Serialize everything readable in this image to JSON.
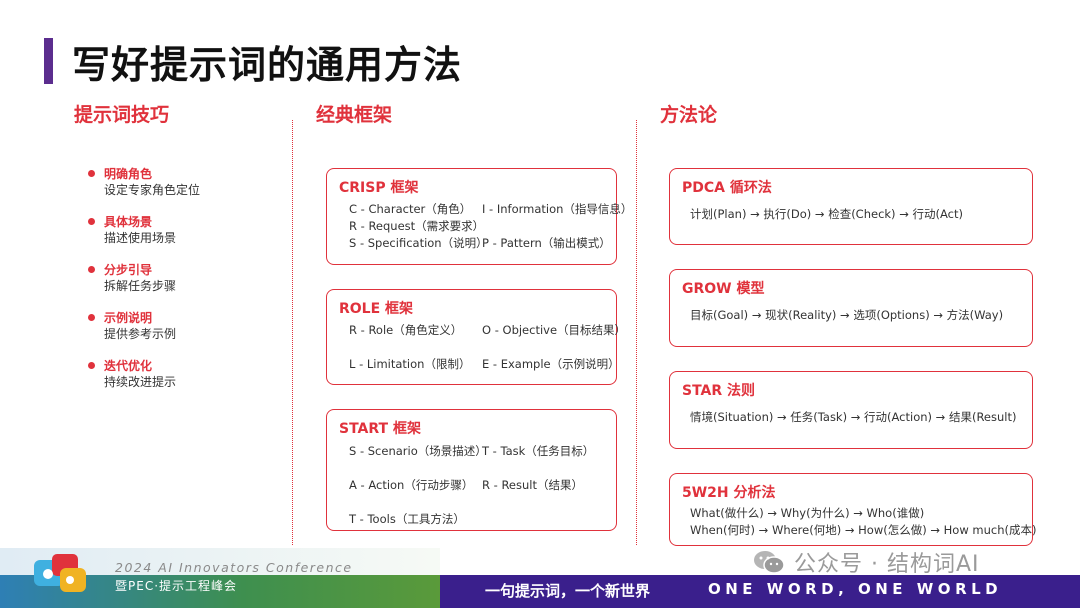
{
  "title": "写好提示词的通用方法",
  "columns": {
    "tips_heading": "提示词技巧",
    "frameworks_heading": "经典框架",
    "methods_heading": "方法论"
  },
  "tips": [
    {
      "head": "明确角色",
      "desc": "设定专家角色定位"
    },
    {
      "head": "具体场景",
      "desc": "描述使用场景"
    },
    {
      "head": "分步引导",
      "desc": "拆解任务步骤"
    },
    {
      "head": "示例说明",
      "desc": "提供参考示例"
    },
    {
      "head": "迭代优化",
      "desc": "持续改进提示"
    }
  ],
  "frameworks": {
    "crisp": {
      "title": "CRISP 框架",
      "c": "C - Character（角色）",
      "i": "I - Information（指导信息）",
      "r": "R - Request（需求要求）",
      "s": "S - Specification（说明）",
      "p": "P - Pattern（输出模式）"
    },
    "role": {
      "title": "ROLE 框架",
      "r": "R - Role（角色定义）",
      "o": "O - Objective（目标结果）",
      "l": "L - Limitation（限制）",
      "e": "E - Example（示例说明）"
    },
    "start": {
      "title": "START 框架",
      "s": "S - Scenario（场景描述）",
      "t": "T - Task（任务目标）",
      "a": "A - Action（行动步骤）",
      "r": "R - Result（结果）",
      "t2": "T - Tools（工具方法）"
    }
  },
  "methods": {
    "pdca": {
      "title": "PDCA 循环法",
      "line": "计划(Plan) → 执行(Do) → 检查(Check) → 行动(Act)"
    },
    "grow": {
      "title": "GROW 模型",
      "line": "目标(Goal) → 现状(Reality) → 选项(Options) → 方法(Way)"
    },
    "star": {
      "title": "STAR 法则",
      "line": "情境(Situation) → 任务(Task) → 行动(Action) → 结果(Result)"
    },
    "w5h2": {
      "title": "5W2H 分析法",
      "line1": "What(做什么) → Why(为什么) → Who(谁做)",
      "line2": "When(何时) → Where(何地) → How(怎么做) → How much(成本)"
    }
  },
  "footer": {
    "conference_en": "2024 AI Innovators Conference",
    "conference_cn": "暨PEC·提示工程峰会",
    "slogan_cn": "一句提示词，一个新世界",
    "slogan_en": "ONE WORD, ONE WORLD"
  },
  "watermark": "公众号 · 结构词AI",
  "colors": {
    "accent": "#e0323c",
    "purple": "#5b2d8e",
    "footer": "#3a1f8c"
  }
}
